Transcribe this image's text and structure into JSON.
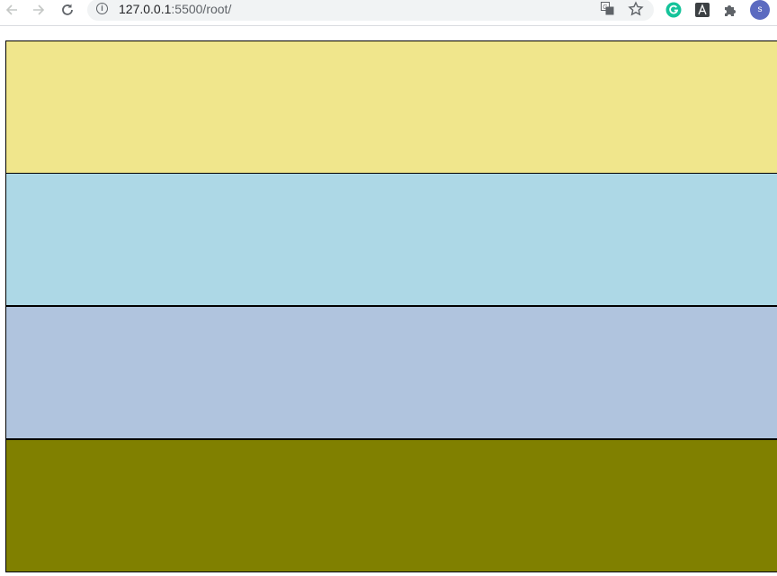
{
  "browser": {
    "address": {
      "host": "127.0.0.1",
      "path": ":5500/root/"
    },
    "avatar_initial": "s",
    "icons": {
      "back": "back-arrow-icon",
      "forward": "forward-arrow-icon",
      "reload": "reload-icon",
      "info": "info-icon",
      "translate": "translate-icon",
      "bookmark": "star-icon",
      "grammarly": "grammarly-icon",
      "extension_a": "extension-a-icon",
      "extensions": "puzzle-icon"
    }
  },
  "page": {
    "bands": [
      {
        "color": "#f0e68c"
      },
      {
        "color": "#add8e6"
      },
      {
        "color": "#b0c4de"
      },
      {
        "color": "#808000"
      }
    ]
  }
}
